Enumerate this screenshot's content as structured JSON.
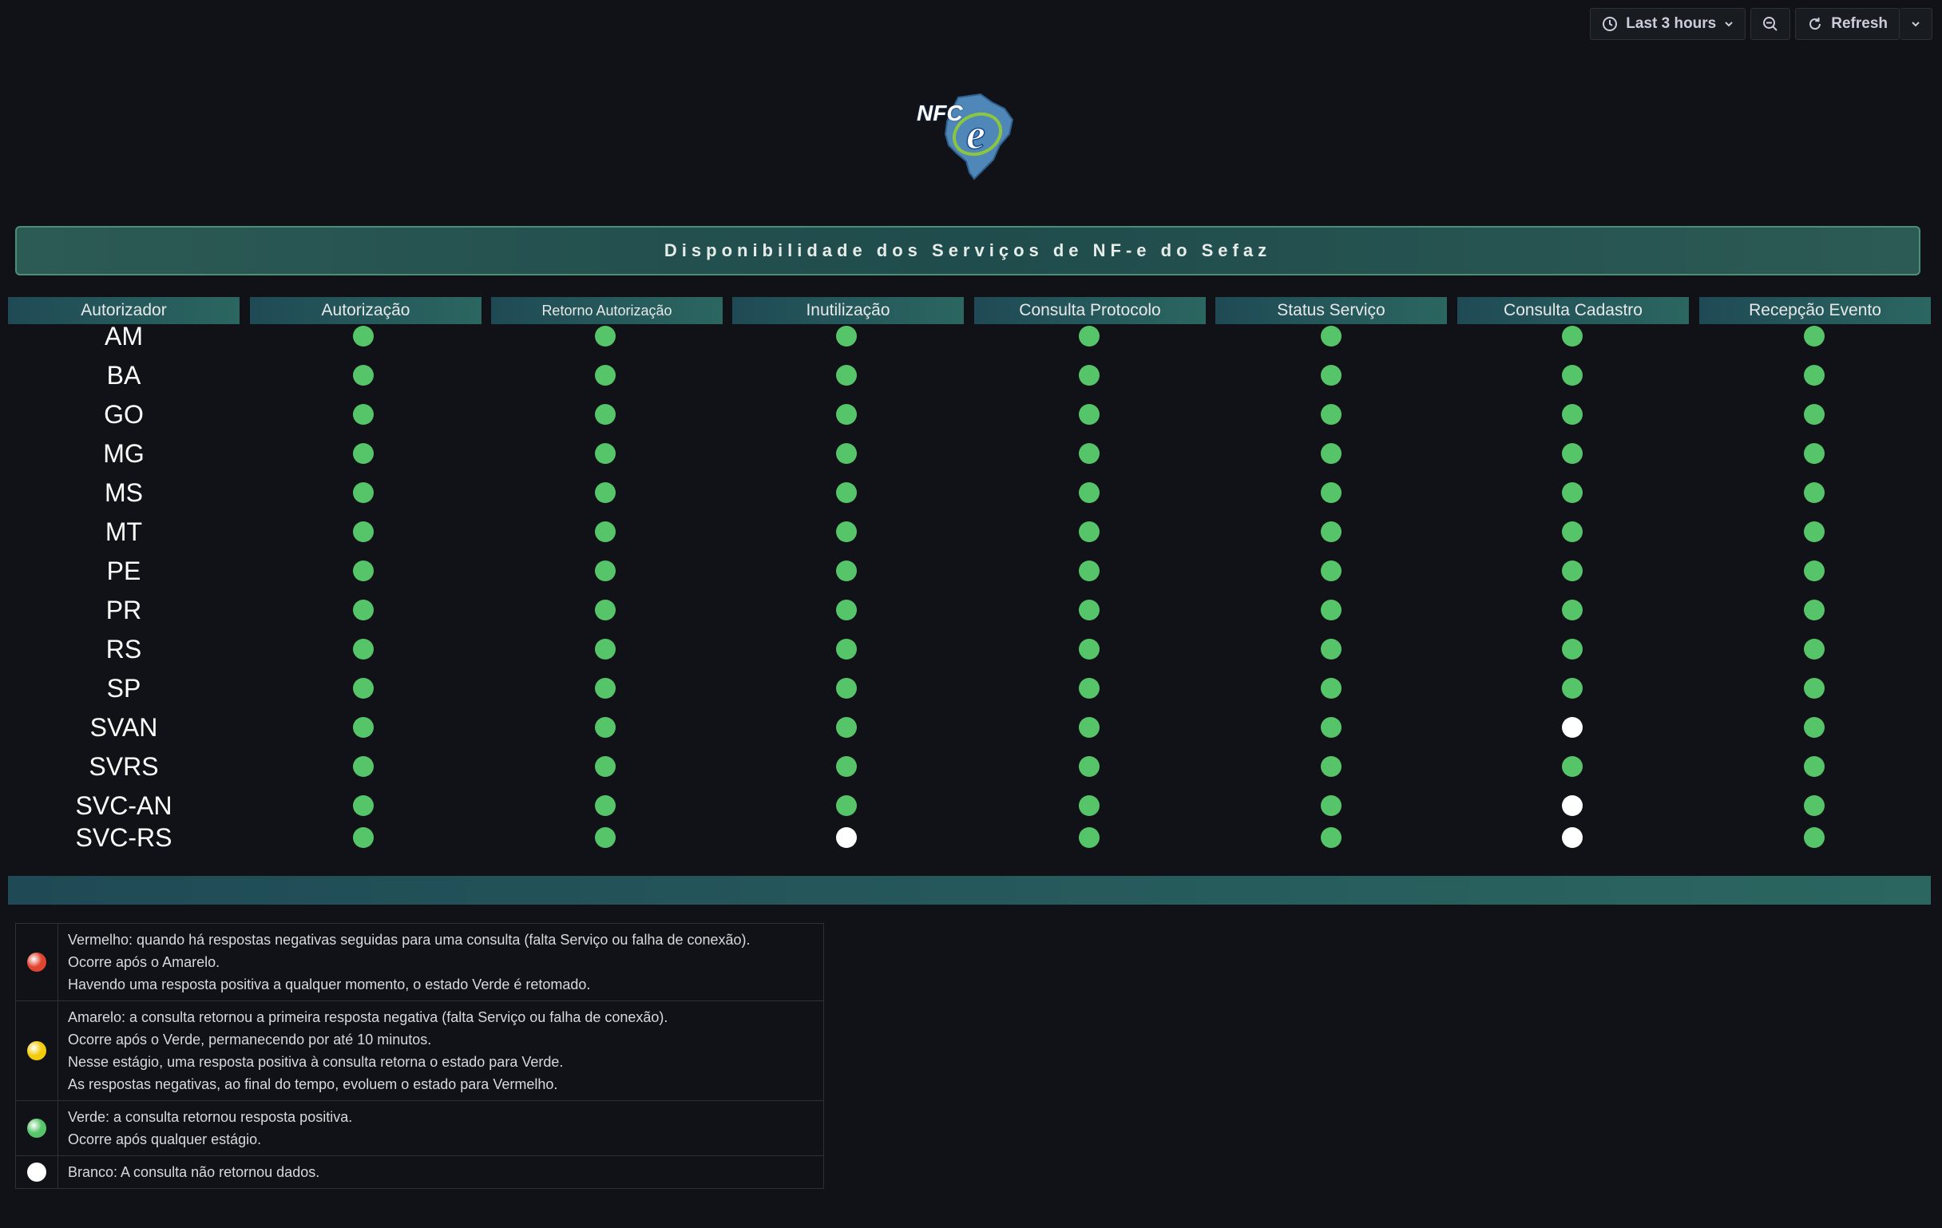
{
  "toolbar": {
    "time_range_label": "Last 3 hours",
    "refresh_label": "Refresh"
  },
  "logo": {
    "text": "NFC"
  },
  "banner": {
    "title": "Disponibilidade dos Serviços de NF-e do Sefaz"
  },
  "table": {
    "columns": [
      "Autorizador",
      "Autorização",
      "Retorno Autorização",
      "Inutilização",
      "Consulta Protocolo",
      "Status Serviço",
      "Consulta Cadastro",
      "Recepção Evento"
    ],
    "rows": [
      {
        "name": "AM",
        "status": [
          "green",
          "green",
          "green",
          "green",
          "green",
          "green",
          "green"
        ]
      },
      {
        "name": "BA",
        "status": [
          "green",
          "green",
          "green",
          "green",
          "green",
          "green",
          "green"
        ]
      },
      {
        "name": "GO",
        "status": [
          "green",
          "green",
          "green",
          "green",
          "green",
          "green",
          "green"
        ]
      },
      {
        "name": "MG",
        "status": [
          "green",
          "green",
          "green",
          "green",
          "green",
          "green",
          "green"
        ]
      },
      {
        "name": "MS",
        "status": [
          "green",
          "green",
          "green",
          "green",
          "green",
          "green",
          "green"
        ]
      },
      {
        "name": "MT",
        "status": [
          "green",
          "green",
          "green",
          "green",
          "green",
          "green",
          "green"
        ]
      },
      {
        "name": "PE",
        "status": [
          "green",
          "green",
          "green",
          "green",
          "green",
          "green",
          "green"
        ]
      },
      {
        "name": "PR",
        "status": [
          "green",
          "green",
          "green",
          "green",
          "green",
          "green",
          "green"
        ]
      },
      {
        "name": "RS",
        "status": [
          "green",
          "green",
          "green",
          "green",
          "green",
          "green",
          "green"
        ]
      },
      {
        "name": "SP",
        "status": [
          "green",
          "green",
          "green",
          "green",
          "green",
          "green",
          "green"
        ]
      },
      {
        "name": "SVAN",
        "status": [
          "green",
          "green",
          "green",
          "green",
          "green",
          "white",
          "green"
        ]
      },
      {
        "name": "SVRS",
        "status": [
          "green",
          "green",
          "green",
          "green",
          "green",
          "green",
          "green"
        ]
      },
      {
        "name": "SVC-AN",
        "status": [
          "green",
          "green",
          "green",
          "green",
          "green",
          "white",
          "green"
        ]
      },
      {
        "name": "SVC-RS",
        "status": [
          "green",
          "green",
          "white",
          "green",
          "green",
          "white",
          "green"
        ]
      }
    ]
  },
  "legend": [
    {
      "color": "red",
      "lines": [
        "Vermelho: quando há respostas negativas seguidas para uma consulta (falta Serviço ou falha de conexão).",
        "Ocorre após o Amarelo.",
        "Havendo uma resposta positiva a qualquer momento, o estado Verde é retomado."
      ]
    },
    {
      "color": "yellow",
      "lines": [
        "Amarelo: a consulta retornou a primeira resposta negativa (falta Serviço ou falha de conexão).",
        "Ocorre após o Verde, permanecendo por até 10 minutos.",
        "Nesse estágio, uma resposta positiva à consulta retorna o estado para Verde.",
        "As respostas negativas, ao final do tempo, evoluem o estado para Vermelho."
      ]
    },
    {
      "color": "green",
      "lines": [
        "Verde: a consulta retornou resposta positiva.",
        "Ocorre após qualquer estágio."
      ]
    },
    {
      "color": "white",
      "lines": [
        "Branco: A consulta não retornou dados."
      ]
    }
  ],
  "colors": {
    "green": "#56c56a",
    "white": "#ffffff",
    "yellow": "#f2cc0c",
    "red": "#e0462f",
    "header_gradient_start": "#1f4a55",
    "header_gradient_end": "#2b6660"
  }
}
